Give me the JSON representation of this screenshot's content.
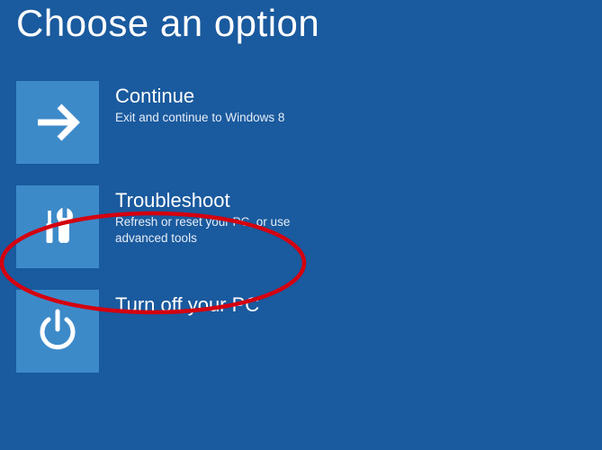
{
  "title": "Choose an option",
  "options": [
    {
      "title": "Continue",
      "desc": "Exit and continue to Windows 8"
    },
    {
      "title": "Troubleshoot",
      "desc": "Refresh or reset your PC, or use advanced tools"
    },
    {
      "title": "Turn off your PC",
      "desc": ""
    }
  ]
}
